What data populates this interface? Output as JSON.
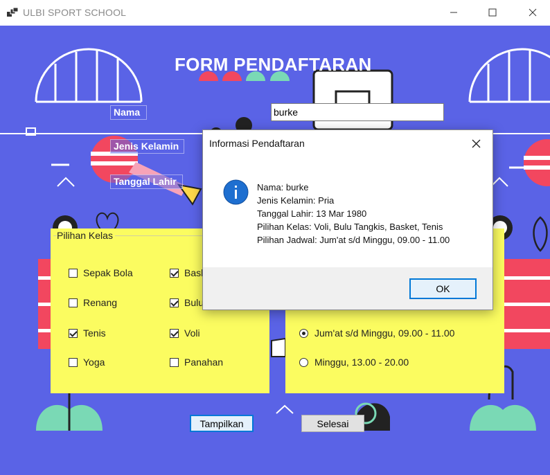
{
  "window": {
    "title": "ULBI SPORT SCHOOL",
    "icon": "app-window-icon"
  },
  "form": {
    "title": "FORM PENDAFTARAN",
    "labels": {
      "nama": "Nama",
      "jenis_kelamin": "Jenis Kelamin",
      "tanggal_lahir": "Tanggal Lahir"
    },
    "nama_value": "burke"
  },
  "kelas": {
    "title": "Pilihan Kelas",
    "items": [
      {
        "label": "Sepak Bola",
        "checked": false
      },
      {
        "label": "Basket",
        "checked": true
      },
      {
        "label": "Renang",
        "checked": false
      },
      {
        "label": "Bulu Tangkis",
        "checked": true
      },
      {
        "label": "Tenis",
        "checked": true
      },
      {
        "label": "Voli",
        "checked": true
      },
      {
        "label": "Yoga",
        "checked": false
      },
      {
        "label": "Panahan",
        "checked": false
      }
    ]
  },
  "jadwal": {
    "options": [
      {
        "label": "Jum'at s/d Minggu, 09.00 - 11.00",
        "selected": true
      },
      {
        "label": "Minggu, 13.00 - 20.00",
        "selected": false
      }
    ]
  },
  "buttons": {
    "tampilkan": "Tampilkan",
    "selesai": "Selesai"
  },
  "dialog": {
    "title": "Informasi Pendaftaran",
    "lines": [
      "Nama: burke",
      "Jenis Kelamin: Pria",
      "Tanggal Lahir: 13 Mar 1980",
      "Pilihan Kelas: Voli, Bulu Tangkis, Basket, Tenis",
      "Pilihan Jadwal: Jum'at s/d Minggu, 09.00 - 11.00"
    ],
    "ok_label": "OK",
    "icon": "info-icon"
  },
  "colors": {
    "background": "#5a63e6",
    "panel": "#fbfc60",
    "accent": "#0078d7",
    "stripe": "#f2475f",
    "mint": "#7ad9b5"
  }
}
